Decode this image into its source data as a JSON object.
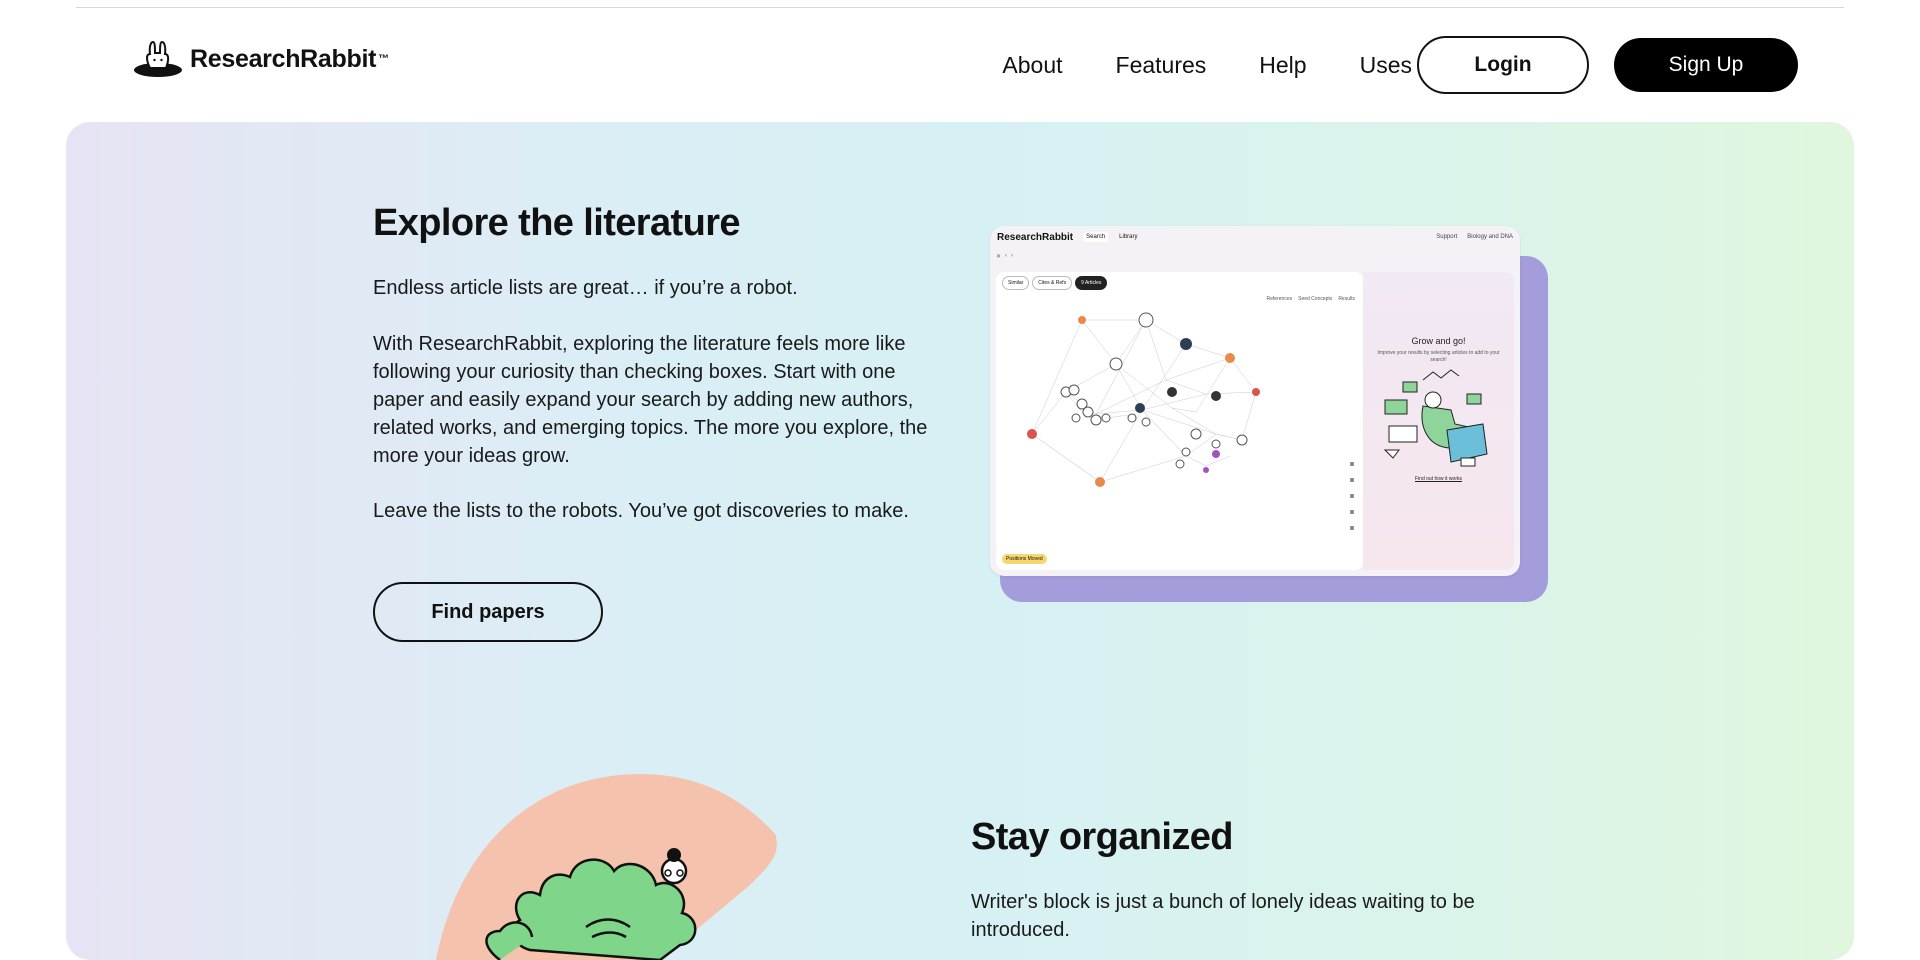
{
  "header": {
    "brand": "ResearchRabbit",
    "brand_tm": "™",
    "nav": [
      "About",
      "Features",
      "Help",
      "Uses"
    ],
    "login": "Login",
    "signup": "Sign Up"
  },
  "explore": {
    "title": "Explore the literature",
    "p1": "Endless article lists are great… if you’re a robot.",
    "p2": "With ResearchRabbit, exploring the literature feels more like following your curiosity than checking boxes. Start with one paper and easily expand your search by adding new authors, related works, and emerging topics. The more you explore, the more your ideas grow.",
    "p3": "Leave the lists to the robots. You’ve got discoveries to make.",
    "cta": "Find papers"
  },
  "screenshot": {
    "brand": "ResearchRabbit",
    "tabs": [
      "Search",
      "Library"
    ],
    "right_links": [
      "Support",
      "Biology and DNA"
    ],
    "chips": [
      "Similar",
      "Cites & Refs",
      "9 Articles"
    ],
    "legend": [
      "References",
      "Seed Concepts",
      "Results"
    ],
    "side_title": "Grow and go!",
    "side_sub": "Improve your results by selecting articles to add to your search!",
    "side_link": "Find out how it works",
    "pill": "Positions Moved"
  },
  "organized": {
    "title": "Stay organized",
    "p1": "Writer's block is just a bunch of lonely ideas waiting to be introduced."
  },
  "colors": {
    "accent_purple": "#a49ddb",
    "illustration_peach": "#f4c2ad",
    "illustration_green": "#7fd68a"
  }
}
